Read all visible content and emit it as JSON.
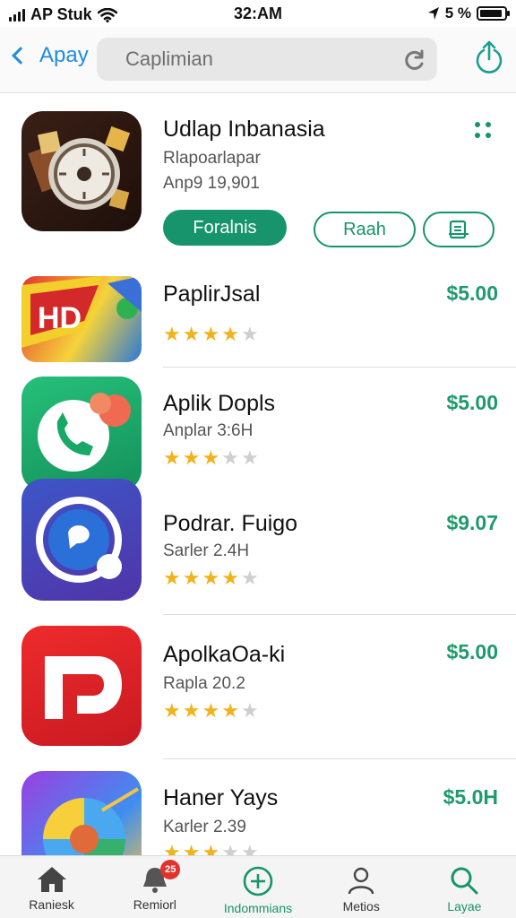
{
  "status_bar": {
    "carrier": "AP Stuk",
    "time": "32:AM",
    "battery": "5 %"
  },
  "nav": {
    "back_label": "Apay",
    "search_value": "Caplimian"
  },
  "featured": {
    "name": "Udlap Inbanasia",
    "subtitle": "Rlapoarlapar",
    "meta": "Anp9 19,901",
    "primary_button": "Foralnis",
    "secondary_button": "Raah"
  },
  "apps": [
    {
      "name": "PaplirJsal",
      "price": "$5.00",
      "subtitle": "",
      "rating": 4
    },
    {
      "name": "Aplik Dopls",
      "price": "$5.00",
      "subtitle": "Anplar 3:6H",
      "rating": 3
    },
    {
      "name": "Podrar. Fuigo",
      "price": "$9.07",
      "subtitle": "Sarler 2.4H",
      "rating": 4
    },
    {
      "name": "ApolkaOa-ki",
      "price": "$5.00",
      "subtitle": "Rapla 20.2",
      "rating": 4
    },
    {
      "name": "Haner Yays",
      "price": "$5.0H",
      "subtitle": "Karler 2.39",
      "rating": 3
    }
  ],
  "tabs": [
    {
      "label": "Raniesk",
      "icon": "home-icon"
    },
    {
      "label": "Remiorl",
      "icon": "bell-icon",
      "badge": "25"
    },
    {
      "label": "Indommians",
      "icon": "add-circle-icon"
    },
    {
      "label": "Metios",
      "icon": "person-icon"
    },
    {
      "label": "Layae",
      "icon": "search-icon"
    }
  ],
  "colors": {
    "accent": "#17946c",
    "link_blue": "#1f8de0",
    "star": "#f1b31c",
    "badge": "#e0332d"
  }
}
